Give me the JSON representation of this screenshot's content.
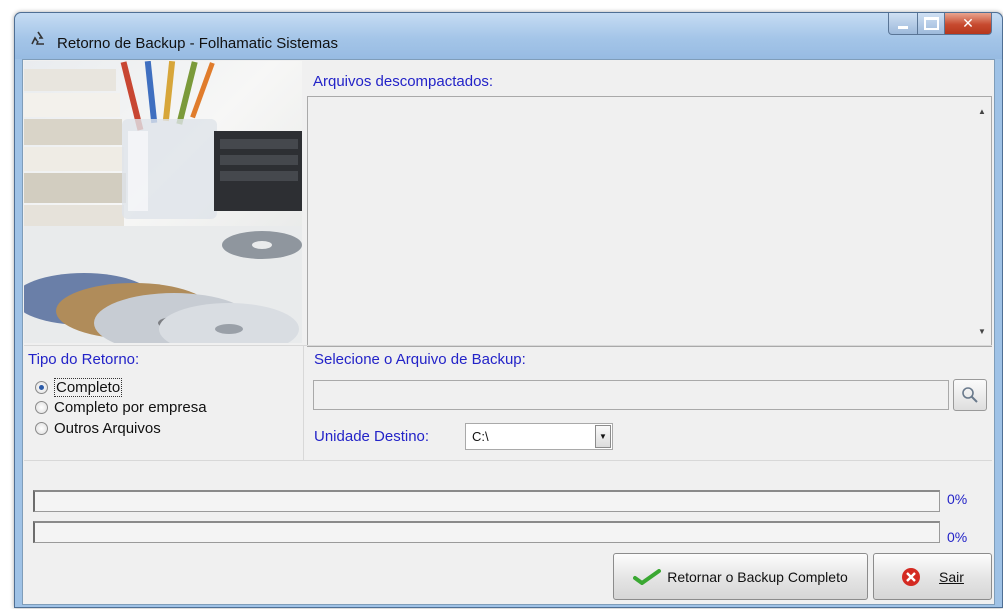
{
  "window": {
    "title": "Retorno de Backup - Folhamatic Sistemas"
  },
  "files": {
    "label": "Arquivos descompactados:",
    "items": []
  },
  "return_type": {
    "label": "Tipo do Retorno:",
    "options": [
      {
        "label": "Completo",
        "checked": true
      },
      {
        "label": "Completo por empresa",
        "checked": false
      },
      {
        "label": "Outros Arquivos",
        "checked": false
      }
    ]
  },
  "backup_file": {
    "label": "Selecione o Arquivo de Backup:",
    "value": "",
    "search_icon": "magnifier-icon"
  },
  "destination": {
    "label": "Unidade Destino:",
    "value": "C:\\"
  },
  "progress": [
    {
      "value": 0,
      "text": "0%"
    },
    {
      "value": 0,
      "text": "0%"
    }
  ],
  "buttons": {
    "restore_label": "Retornar o Backup Completo",
    "restore_icon": "checkmark-icon",
    "exit_label": "Sair",
    "exit_icon": "cancel-icon"
  },
  "colors": {
    "label_blue": "#2323c8",
    "check_green": "#3aa832",
    "cancel_red": "#d42a22"
  }
}
